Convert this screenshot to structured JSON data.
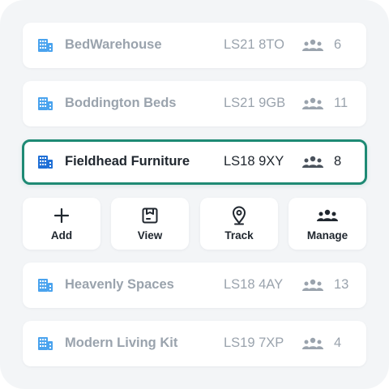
{
  "colors": {
    "accent": "#1e8a74",
    "building_icon": "#4aa3ee",
    "faded_text": "#9aa3ad",
    "dark_text": "#20272f"
  },
  "locations": [
    {
      "name": "BedWarehouse",
      "postcode": "LS21 8TO",
      "count": "6",
      "selected": false
    },
    {
      "name": "Boddington Beds",
      "postcode": "LS21 9GB",
      "count": "11",
      "selected": false
    },
    {
      "name": "Fieldhead Furniture",
      "postcode": "LS18 9XY",
      "count": "8",
      "selected": true
    },
    {
      "name": "Heavenly Spaces",
      "postcode": "LS18 4AY",
      "count": "13",
      "selected": false
    },
    {
      "name": "Modern Living Kit",
      "postcode": "LS19 7XP",
      "count": "4",
      "selected": false
    }
  ],
  "actions": [
    {
      "label": "Add",
      "icon": "plus-icon"
    },
    {
      "label": "View",
      "icon": "save-box-icon"
    },
    {
      "label": "Track",
      "icon": "map-pin-icon"
    },
    {
      "label": "Manage",
      "icon": "people-icon"
    }
  ]
}
